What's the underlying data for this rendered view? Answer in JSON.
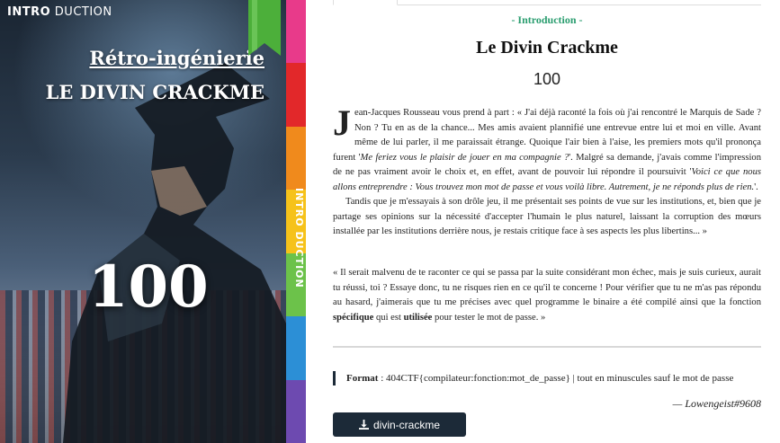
{
  "cover": {
    "brand_bold": "INTRO",
    "brand_light": " DUCTION",
    "category": "Rétro-ingénierie",
    "title": "LE DIVIN CRACKME",
    "score": "100",
    "spine_text": "INTRO DUCTION",
    "spine_colors": [
      "#e83a8a",
      "#e2282a",
      "#f08a1c",
      "#f6c21a",
      "#6cc24a",
      "#2c8fd6",
      "#6d4ab0"
    ],
    "ribbon_color": "#4caf3a"
  },
  "challenge": {
    "section": "- Introduction -",
    "title": "Le Divin Crackme",
    "points": "100",
    "story": {
      "dropcap": "J",
      "p1_a": "ean-Jacques Rousseau vous prend à part : « J'ai déjà raconté la fois où j'ai rencontré le Marquis de Sade ? Non ? Tu en as de la chance... Mes amis avaient plannifié une entrevue entre lui et moi en ville. Avant même de lui parler, il me paraissait étrange. Quoique l'air bien à l'aise, les premiers mots qu'il prononça furent '",
      "p1_italic1": "Me feriez vous le plaisir de jouer en ma compagnie ?",
      "p1_b": "'. Malgré sa demande, j'avais comme l'impression de ne pas vraiment avoir le choix et, en effet, avant de pouvoir lui répondre il poursuivit '",
      "p1_italic2": "Voici ce que nous allons entreprendre : Vous trouvez mon mot de passe et vous voilà libre. Autrement, je ne réponds plus de rien.",
      "p1_c": "'.",
      "p2": "Tandis que je m'essayais à son drôle jeu, il me présentait ses points de vue sur les institutions, et, bien que je partage ses opinions sur la nécessité d'accepter l'humain le plus naturel, laissant la corruption des mœurs installée par les institutions derrière nous, je restais critique face à ses aspects les plus libertins... »"
    },
    "quote": {
      "a": "« Il serait malvenu de te raconter ce qui se passa par la suite considérant mon échec, mais je suis curieux, aurait tu réussi, toi ? Essaye donc, tu ne risques rien en ce qu'il te concerne ! Pour vérifier que tu ne m'as pas répondu au hasard, j'aimerais que tu me précises avec quel programme le binaire a été compilé ainsi que la fonction ",
      "bold1": "spécifique",
      "b": " qui est ",
      "bold2": "utilisée",
      "c": " pour tester le mot de passe. »"
    },
    "format_label": "Format",
    "format_value": " : 404CTF{compilateur:fonction:mot_de_passe} | tout en minuscules sauf le mot de passe",
    "author": "— Lowengeist#9608",
    "download_label": "divin-crackme",
    "download_icon": "download-icon"
  }
}
